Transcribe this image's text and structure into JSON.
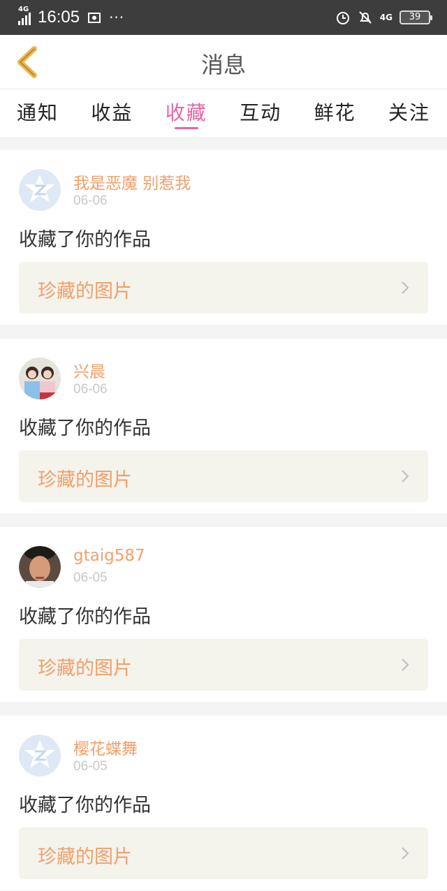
{
  "status_bar": {
    "network": "4G",
    "time": "16:05",
    "more": "···",
    "network_right": "4G",
    "battery": "39"
  },
  "header": {
    "title": "消息"
  },
  "tabs": [
    {
      "label": "通知",
      "active": false
    },
    {
      "label": "收益",
      "active": false
    },
    {
      "label": "收藏",
      "active": true
    },
    {
      "label": "互动",
      "active": false
    },
    {
      "label": "鲜花",
      "active": false
    },
    {
      "label": "关注",
      "active": false
    }
  ],
  "messages": [
    {
      "username": "我是恶魔 别惹我",
      "date": "06-06",
      "action": "收藏了你的作品",
      "work": "珍藏的图片",
      "avatar": "default-avatar"
    },
    {
      "username": "兴晨",
      "date": "06-06",
      "action": "收藏了你的作品",
      "work": "珍藏的图片",
      "avatar": "photo-avatar"
    },
    {
      "username": "gtaig587",
      "date": "06-05",
      "action": "收藏了你的作品",
      "work": "珍藏的图片",
      "avatar": "photo-avatar"
    },
    {
      "username": "樱花蝶舞",
      "date": "06-05",
      "action": "收藏了你的作品",
      "work": "珍藏的图片",
      "avatar": "default-avatar"
    }
  ],
  "colors": {
    "accent": "#e964a3",
    "username": "#f0a06b",
    "back_arrow": "#f2b84b",
    "status_bar": "#3d3d3d"
  }
}
